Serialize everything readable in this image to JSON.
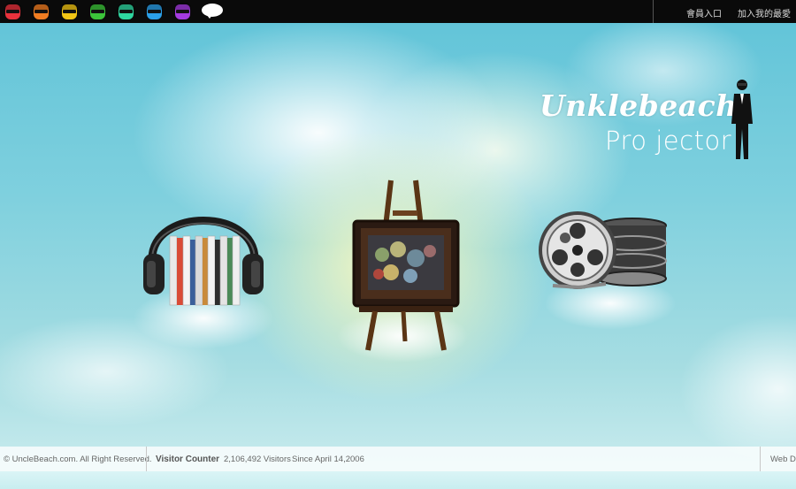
{
  "topbar": {
    "character_icons": [
      {
        "name": "red-character-icon",
        "color": "#e8323c"
      },
      {
        "name": "orange-character-icon",
        "color": "#f07d22"
      },
      {
        "name": "yellow-character-icon",
        "color": "#f2c515"
      },
      {
        "name": "green-character-icon",
        "color": "#3cc43a"
      },
      {
        "name": "teal-character-icon",
        "color": "#2fd6a0"
      },
      {
        "name": "blue-character-icon",
        "color": "#2b9fe8"
      },
      {
        "name": "purple-character-icon",
        "color": "#a43be0"
      }
    ],
    "chat_icon": "speech-bubble-icon",
    "links": {
      "member_login": "會員入口",
      "add_favorite": "加入我的最愛"
    }
  },
  "logo": {
    "title": "Unklebeach",
    "subtitle": "Pro jector"
  },
  "sections": [
    {
      "name": "music",
      "icon": "headphones-cd-stack-icon"
    },
    {
      "name": "art",
      "icon": "easel-painting-icon"
    },
    {
      "name": "film",
      "icon": "film-reel-icon"
    }
  ],
  "footer": {
    "copyright": "© UncleBeach.com. All Right Reserved.",
    "visitor_label": "Visitor Counter",
    "visitor_count": "2,106,492 Visitors",
    "since": "Since April 14,2006",
    "web_design": "Web De"
  }
}
